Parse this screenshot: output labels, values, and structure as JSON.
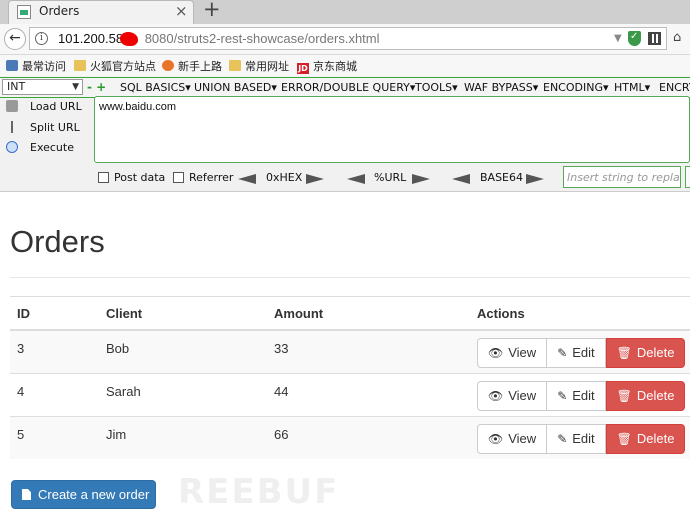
{
  "browser": {
    "tab_title": "Orders",
    "tab_close": "×",
    "new_tab": "+",
    "back": "←",
    "info": "i",
    "url_host": "101.200.58.",
    "url_rest": "8080/struts2-rest-showcase/orders.xhtml",
    "url_dropdown": "▼",
    "nav_right": "⌂"
  },
  "bookmarks": [
    {
      "label": "最常访问",
      "icon": "bookmark-icon"
    },
    {
      "label": "火狐官方站点",
      "icon": "folder-icon"
    },
    {
      "label": "新手上路",
      "icon": "firefox-icon"
    },
    {
      "label": "常用网址",
      "icon": "folder-icon"
    },
    {
      "label": "京东商城",
      "icon": "jd-icon",
      "icon_text": "JD"
    }
  ],
  "hackbar": {
    "select_value": "INT",
    "plus_minus": "- +",
    "menus": [
      "SQL BASICS▾",
      "UNION BASED▾",
      "ERROR/DOUBLE QUERY▾",
      "TOOLS▾",
      "WAF BYPASS▾",
      "ENCODING▾",
      "HTML▾",
      "ENCRY"
    ],
    "side": [
      "Load URL",
      "Split URL",
      "Execute"
    ],
    "url_value": "www.baidu.com",
    "post_data": "Post data",
    "referrer": "Referrer",
    "hex": "0xHEX",
    "urlenc": "%URL",
    "base64": "BASE64",
    "replace_placeholder": "Insert string to replace"
  },
  "page": {
    "title": "Orders",
    "columns": [
      "ID",
      "Client",
      "Amount",
      "Actions"
    ],
    "rows": [
      {
        "id": "3",
        "client": "Bob",
        "amount": "33"
      },
      {
        "id": "4",
        "client": "Sarah",
        "amount": "44"
      },
      {
        "id": "5",
        "client": "Jim",
        "amount": "66"
      }
    ],
    "actions": {
      "view": "View",
      "edit": "Edit",
      "delete": "Delete"
    },
    "create_label": "Create a new order"
  },
  "watermark": "REEBUF",
  "colors": {
    "primary": "#337ab7",
    "danger": "#d9534f",
    "hackbar_green": "#38a838"
  }
}
